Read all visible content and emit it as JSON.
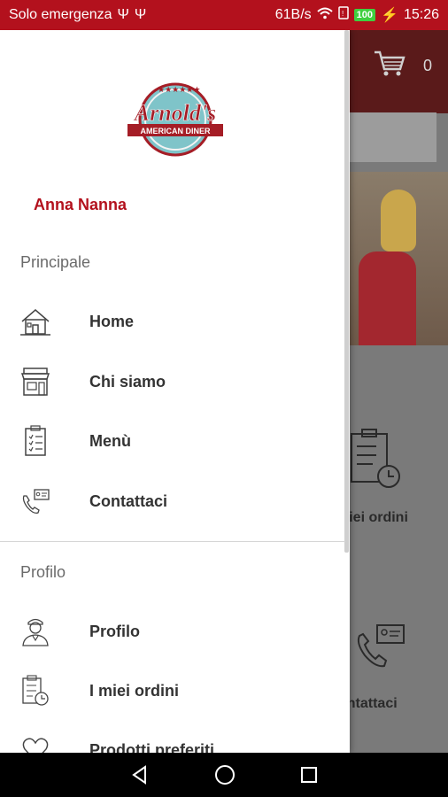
{
  "status_bar": {
    "carrier": "Solo emergenza",
    "speed": "61B/s",
    "battery": "100",
    "time": "15:26"
  },
  "background_app": {
    "cart_count": "0",
    "tile_label_1": "miei ordini",
    "tile_label_2": "ontattaci"
  },
  "drawer": {
    "user_name": "Anna Nanna",
    "sections": {
      "main_title": "Principale",
      "profile_title": "Profilo"
    },
    "main_items": [
      {
        "label": "Home",
        "icon": "house-icon"
      },
      {
        "label": "Chi siamo",
        "icon": "storefront-icon"
      },
      {
        "label": "Menù",
        "icon": "clipboard-list-icon"
      },
      {
        "label": "Contattaci",
        "icon": "phone-contact-icon"
      }
    ],
    "profile_items": [
      {
        "label": "Profilo",
        "icon": "person-icon"
      },
      {
        "label": "I miei ordini",
        "icon": "orders-clock-icon"
      },
      {
        "label": "Prodotti preferiti",
        "icon": "heart-icon"
      }
    ]
  },
  "logo": {
    "text": "Arnold's",
    "subtext": "AMERICAN DINER"
  },
  "colors": {
    "brand_red": "#b3111d",
    "logo_teal": "#7fc4c9"
  }
}
